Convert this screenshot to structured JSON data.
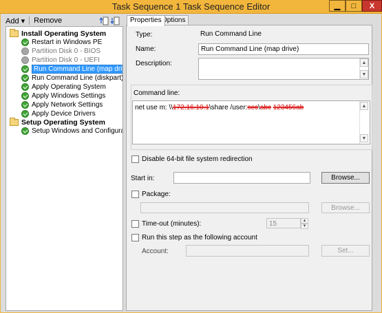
{
  "window": {
    "title": "Task Sequence 1 Task Sequence Editor",
    "min_glyph": "▁",
    "max_glyph": "□",
    "close_glyph": "X"
  },
  "toolbar": {
    "add": "Add ▾",
    "remove": "Remove"
  },
  "tree": {
    "groups": [
      {
        "label": "Install Operating System",
        "items": [
          {
            "label": "Restart in Windows PE",
            "state": "ok"
          },
          {
            "label": "Partition Disk 0 - BIOS",
            "state": "disabled"
          },
          {
            "label": "Partition Disk 0 - UEFI",
            "state": "disabled"
          },
          {
            "label": "Run Command Line (map drive)",
            "state": "selected"
          },
          {
            "label": "Run Command Line (diskpart)",
            "state": "ok"
          },
          {
            "label": "Apply Operating System",
            "state": "ok"
          },
          {
            "label": "Apply Windows Settings",
            "state": "ok"
          },
          {
            "label": "Apply Network Settings",
            "state": "ok"
          },
          {
            "label": "Apply Device Drivers",
            "state": "ok"
          }
        ]
      },
      {
        "label": "Setup Operating System",
        "items": [
          {
            "label": "Setup Windows and Configuration",
            "state": "ok"
          }
        ]
      }
    ]
  },
  "tabs": {
    "properties": "Properties",
    "options": "Options"
  },
  "props": {
    "type_label": "Type:",
    "type_value": "Run Command Line",
    "name_label": "Name:",
    "name_value": "Run Command Line (map drive)",
    "desc_label": "Description:",
    "desc_value": "",
    "cmd_label": "Command line:",
    "cmd_prefix": "net use m: \\\\",
    "cmd_ip": "172.16.10.1",
    "cmd_share": "\\share /user:",
    "cmd_user": "sec",
    "cmd_sep": "\\",
    "cmd_acct": "abc",
    "cmd_pass": "123456ab",
    "disable64_label": "Disable 64-bit file system redirection",
    "startin_label": "Start in:",
    "startin_value": "",
    "browse1": "Browse...",
    "package_label": "Package:",
    "package_value": "",
    "browse2": "Browse...",
    "timeout_label": "Time-out (minutes):",
    "timeout_value": "15",
    "runas_label": "Run this step as the following account",
    "account_label": "Account:",
    "account_value": "",
    "set_label": "Set..."
  },
  "colors": {
    "title_bar": "#f3b63c",
    "selection": "#3399ff",
    "ok_green": "#3fa535",
    "strike_red": "#e02020"
  },
  "icons": [
    "folder-icon",
    "check-icon",
    "disabled-step-icon",
    "up-icon",
    "down-icon",
    "minimize-icon",
    "maximize-icon",
    "close-icon"
  ]
}
